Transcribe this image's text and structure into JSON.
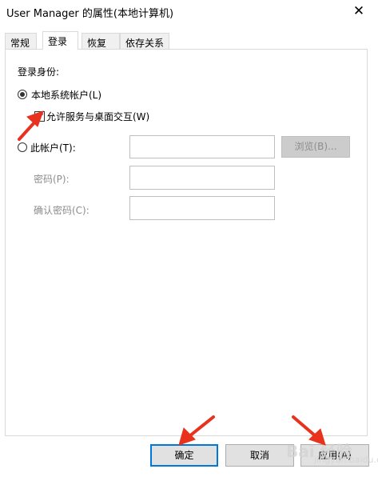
{
  "window": {
    "title": "User Manager 的属性(本地计算机)",
    "close_glyph": "✕"
  },
  "tabs": [
    {
      "label": "常规",
      "active": false
    },
    {
      "label": "登录",
      "active": true
    },
    {
      "label": "恢复",
      "active": false
    },
    {
      "label": "依存关系",
      "active": false
    }
  ],
  "logon": {
    "section_label": "登录身份:",
    "local_system_label": "本地系统帐户(L)",
    "allow_desktop_label": "允许服务与桌面交互(W)",
    "allow_desktop_checked": true,
    "this_account_label": "此帐户(T):",
    "this_account_value": "",
    "browse_label": "浏览(B)...",
    "password_label": "密码(P):",
    "password_value": "",
    "confirm_password_label": "确认密码(C):",
    "confirm_password_value": "",
    "selected": "local_system"
  },
  "footer": {
    "ok_label": "确定",
    "cancel_label": "取消",
    "apply_label": "应用(A)"
  },
  "watermark": {
    "main": "Bai 经验",
    "sub": "jingyan.baidu.com"
  },
  "colors": {
    "arrow": "#e8321e",
    "focus_border": "#0078d7"
  }
}
